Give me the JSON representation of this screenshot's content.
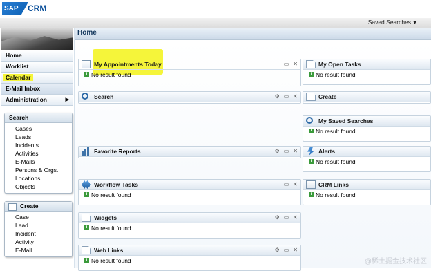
{
  "logo": {
    "sap": "SAP",
    "crm": "CRM"
  },
  "header": {
    "saved_searches": "Saved Searches"
  },
  "nav": {
    "items": [
      "Home",
      "Worklist",
      "Calendar",
      "E-Mail Inbox",
      "Administration"
    ]
  },
  "search_panel": {
    "title": "Search",
    "items": [
      "Cases",
      "Leads",
      "Incidents",
      "Activities",
      "E-Mails",
      "Persons & Orgs.",
      "Locations",
      "Objects"
    ]
  },
  "create_panel": {
    "title": "Create",
    "items": [
      "Case",
      "Lead",
      "Incident",
      "Activity",
      "E-Mail"
    ]
  },
  "page": {
    "title": "Home"
  },
  "widgets": {
    "appointments": {
      "title": "My Appointments Today",
      "body": "No result found"
    },
    "search": {
      "title": "Search"
    },
    "favorite_reports": {
      "title": "Favorite Reports"
    },
    "workflow_tasks": {
      "title": "Workflow Tasks",
      "body": "No result found"
    },
    "widgets": {
      "title": "Widgets",
      "body": "No result found"
    },
    "web_links": {
      "title": "Web Links",
      "body": "No result found"
    },
    "open_tasks": {
      "title": "My Open Tasks",
      "body": "No result found"
    },
    "create": {
      "title": "Create"
    },
    "saved_searches": {
      "title": "My Saved Searches",
      "body": "No result found"
    },
    "alerts": {
      "title": "Alerts",
      "body": "No result found"
    },
    "crm_links": {
      "title": "CRM Links",
      "body": "No result found"
    }
  },
  "watermark": "@稀土掘金技术社区",
  "colors": {
    "highlight": "#f5f53a",
    "accent": "#0a4f9a"
  }
}
